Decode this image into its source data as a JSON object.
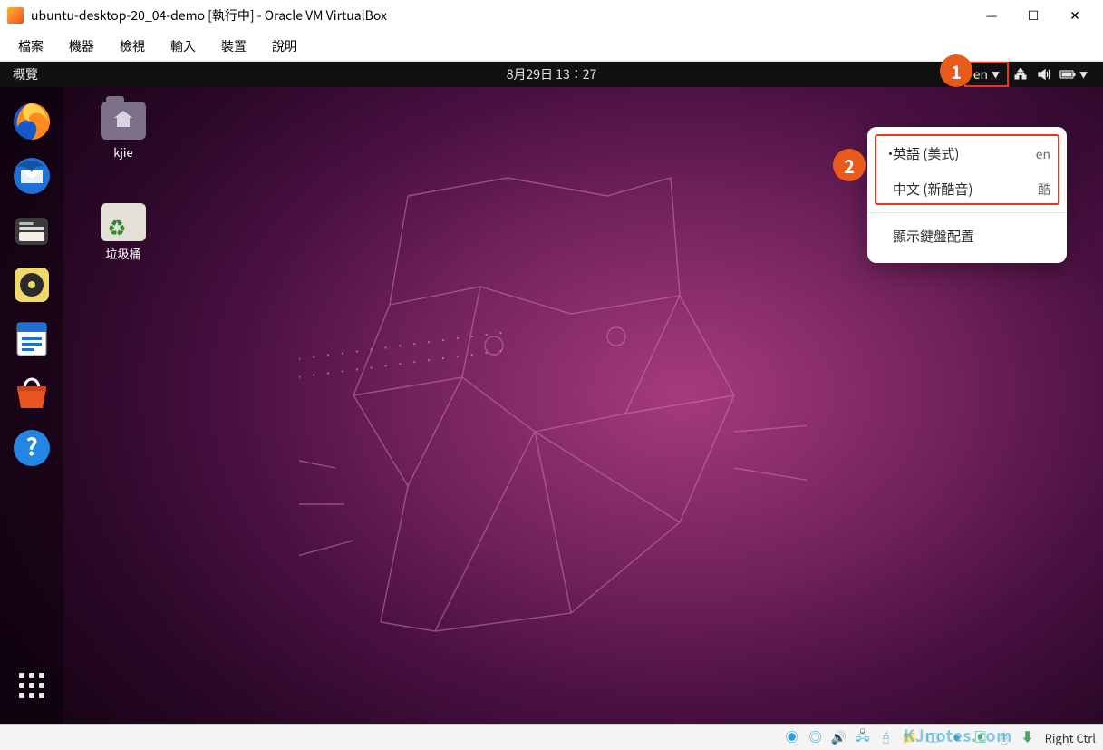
{
  "host_window": {
    "title": "ubuntu-desktop-20_04-demo [執行中] - Oracle VM VirtualBox",
    "menu": [
      "檔案",
      "機器",
      "檢視",
      "輸入",
      "裝置",
      "說明"
    ],
    "win_buttons": {
      "min": "—",
      "max": "☐",
      "close": "✕"
    }
  },
  "panel": {
    "activities": "概覽",
    "datetime": "8月29日 13：27",
    "lang_code": "en"
  },
  "desktop_icons": {
    "home_label": "kjie",
    "trash_label": "垃圾桶"
  },
  "ime_popup": {
    "items": [
      {
        "label": "英語 (美式)",
        "code": "en",
        "selected": true
      },
      {
        "label": "中文 (新酷音)",
        "code": "酷",
        "selected": false
      }
    ],
    "show_layout": "顯示鍵盤配置"
  },
  "markers": {
    "one": "1",
    "two": "2"
  },
  "statusbar": {
    "hostkey": "Right Ctrl"
  },
  "watermark": "KJnotes.com",
  "icons": {
    "network": "network-icon",
    "sound": "sound-icon",
    "battery": "battery-icon",
    "firefox": "firefox-icon",
    "thunderbird": "thunderbird-icon",
    "files": "files-icon",
    "rhythmbox": "rhythmbox-icon",
    "writer": "libreoffice-writer-icon",
    "software": "ubuntu-software-icon",
    "help": "help-icon",
    "apps": "show-apps-icon"
  }
}
